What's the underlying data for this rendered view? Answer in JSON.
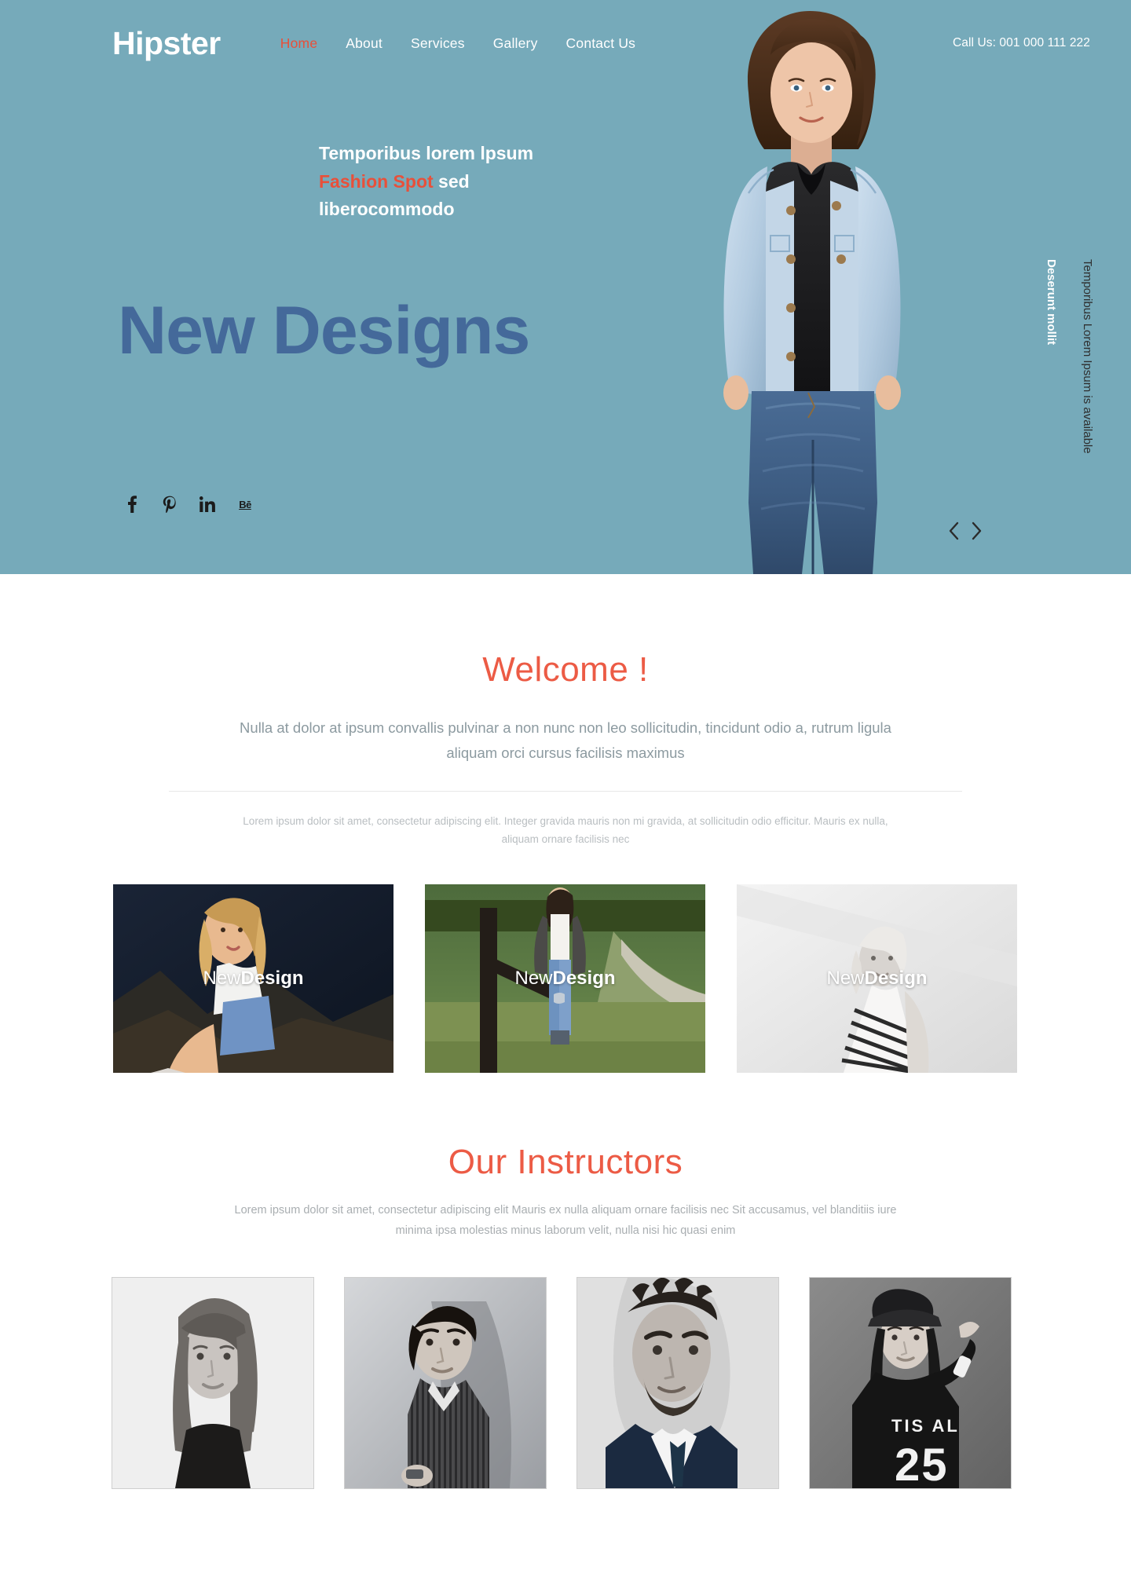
{
  "header": {
    "brand": "Hipster",
    "nav": [
      {
        "label": "Home",
        "active": true
      },
      {
        "label": "About",
        "active": false
      },
      {
        "label": "Services",
        "active": false
      },
      {
        "label": "Gallery",
        "active": false
      },
      {
        "label": "Contact Us",
        "active": false
      }
    ],
    "call_us": "Call Us: 001 000 111 222"
  },
  "hero": {
    "tagline_line1": "Temporibus lorem lpsum",
    "tagline_highlight": "Fashion Spot",
    "tagline_line2_rest": " sed",
    "tagline_line3": "liberocommodo",
    "big_title": "New Designs",
    "side_text_white": "Deserunt mollit",
    "side_text_dark": "Temporibus Lorem Ipsum is available",
    "socials": [
      {
        "name": "facebook-icon",
        "glyph": "f"
      },
      {
        "name": "pinterest-icon",
        "glyph": "P"
      },
      {
        "name": "linkedin-icon",
        "glyph": "in"
      },
      {
        "name": "behance-icon",
        "glyph": "Bē"
      }
    ],
    "prev_label": "Previous slide",
    "next_label": "Next slide"
  },
  "welcome": {
    "title": "Welcome !",
    "lead": "Nulla at dolor at ipsum convallis pulvinar a non nunc non leo sollicitudin, tincidunt odio a, rutrum ligula aliquam orci cursus facilisis maximus",
    "sub": "Lorem ipsum dolor sit amet, consectetur adipiscing elit. Integer gravida mauris non mi gravida, at sollicitudin odio efficitur. Mauris ex nulla, aliquam ornare facilisis nec"
  },
  "gallery": {
    "cards": [
      {
        "caption_light": "New",
        "caption_bold": "Design",
        "alt": "woman sitting on rocks in denim"
      },
      {
        "caption_light": "New",
        "caption_bold": "Design",
        "alt": "woman standing by fence on grass path"
      },
      {
        "caption_light": "New",
        "caption_bold": "Design",
        "alt": "woman in striped dress black and white"
      }
    ]
  },
  "instructors": {
    "title": "Our Instructors",
    "sub": "Lorem ipsum dolor sit amet, consectetur adipiscing elit Mauris ex nulla aliquam ornare facilisis nec Sit accusamus, vel blanditiis iure minima ipsa molestias minus laborum velit, nulla nisi hic quasi enim",
    "people": [
      {
        "alt": "woman with long straight hair portrait"
      },
      {
        "alt": "man in striped shirt side profile"
      },
      {
        "alt": "bearded man in suit and tie"
      },
      {
        "alt": "woman in cap and jersey"
      }
    ]
  },
  "colors": {
    "hero_bg": "#76aaba",
    "accent_red": "#e8503a",
    "headline_blue": "#44699a",
    "section_title_red": "#ec5b45",
    "body_text": "#8c9aa0",
    "muted_text": "#b9bec1",
    "white": "#ffffff"
  }
}
